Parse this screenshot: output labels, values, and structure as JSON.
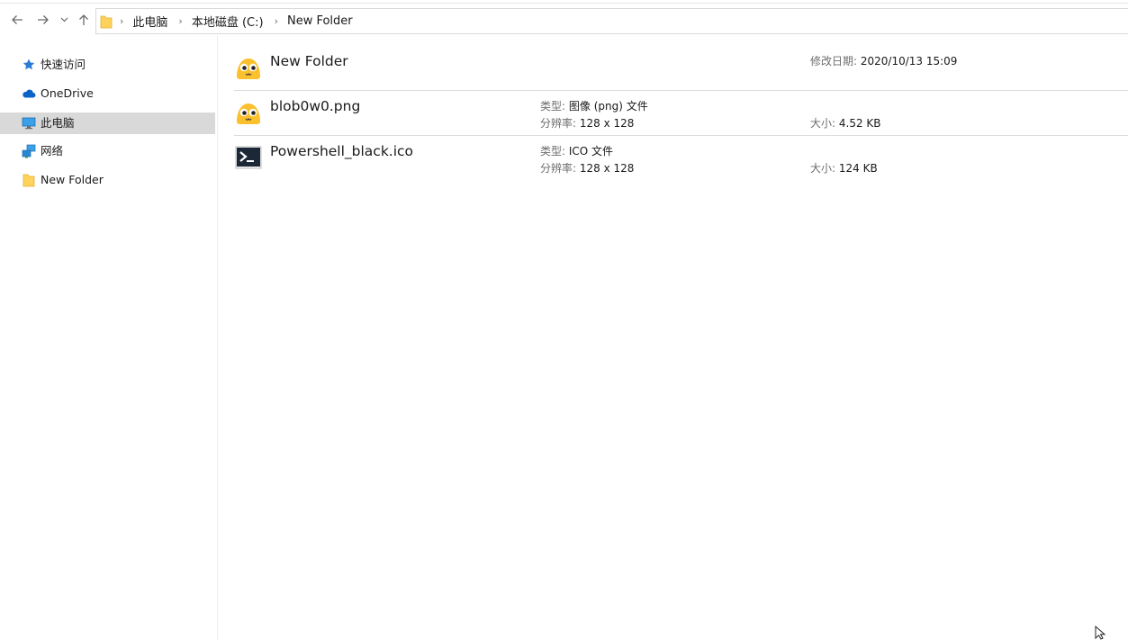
{
  "address": {
    "crumbs": [
      "此电脑",
      "本地磁盘 (C:)",
      "New Folder"
    ]
  },
  "sidebar": {
    "items": [
      {
        "label": "快速访问",
        "icon": "star-pin-icon"
      },
      {
        "label": "OneDrive",
        "icon": "cloud-icon"
      },
      {
        "label": "此电脑",
        "icon": "computer-icon",
        "selected": true
      },
      {
        "label": "网络",
        "icon": "network-icon"
      },
      {
        "label": "New Folder",
        "icon": "folder-icon"
      }
    ]
  },
  "files": [
    {
      "name": "New Folder",
      "icon": "blob-face-icon",
      "modified_label": "修改日期:",
      "modified_value": "2020/10/13 15:09"
    },
    {
      "name": "blob0w0.png",
      "icon": "blob-face-icon",
      "type_label": "类型:",
      "type_value": "图像 (png) 文件",
      "res_label": "分辨率:",
      "res_value": "128 x 128",
      "size_label": "大小:",
      "size_value": "4.52 KB"
    },
    {
      "name": "Powershell_black.ico",
      "icon": "powershell-icon",
      "type_label": "类型:",
      "type_value": "ICO 文件",
      "res_label": "分辨率:",
      "res_value": "128 x 128",
      "size_label": "大小:",
      "size_value": "124 KB"
    }
  ],
  "colors": {
    "selection": "#d9d9d9",
    "folder": "#ffd35b",
    "blob": "#fbc02d",
    "accent": "#0a64c8"
  }
}
